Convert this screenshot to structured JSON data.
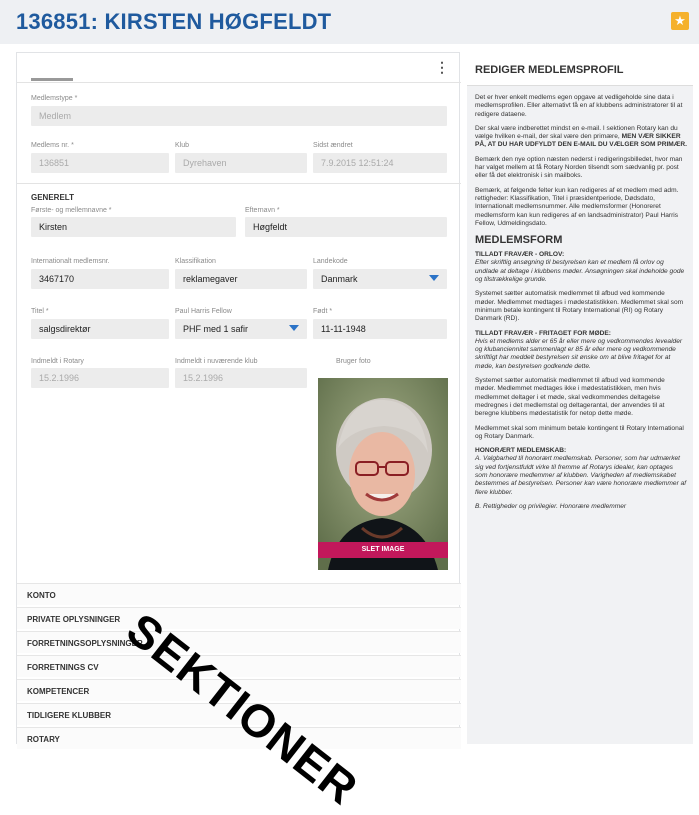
{
  "header": {
    "title": "136851: KIRSTEN HØGFELDT"
  },
  "left": {
    "fields": {
      "medlemstype": {
        "label": "Medlemstype *",
        "value": "Medlem"
      },
      "medlemsnr": {
        "label": "Medlems nr. *",
        "value": "136851"
      },
      "klub": {
        "label": "Klub",
        "value": "Dyrehaven"
      },
      "sidst": {
        "label": "Sidst ændret",
        "value": "7.9.2015 12:51:24"
      },
      "section_generelt": "GENERELT",
      "fornavn": {
        "label": "Første- og mellemnavne *",
        "value": "Kirsten"
      },
      "efternavn": {
        "label": "Efternavn *",
        "value": "Høgfeldt"
      },
      "intl": {
        "label": "Internationalt medlemsnr.",
        "value": "3467170"
      },
      "klass": {
        "label": "Klassifikation",
        "value": "reklamegaver"
      },
      "land": {
        "label": "Landekode",
        "value": "Danmark"
      },
      "titel": {
        "label": "Titel *",
        "value": "salgsdirektør"
      },
      "phf": {
        "label": "Paul Harris Fellow",
        "value": "PHF med 1 safir"
      },
      "fodt": {
        "label": "Født *",
        "value": "11-11-1948"
      },
      "indmeldt_rotary": {
        "label": "Indmeldt i Rotary",
        "value": "15.2.1996"
      },
      "indmeldt_klub": {
        "label": "Indmeldt i nuværende klub",
        "value": "15.2.1996"
      },
      "photo_label": "Bruger foto"
    },
    "delete_image": "SLET IMAGE",
    "accordion": [
      "KONTO",
      "PRIVATE OPLYSNINGER",
      "FORRETNINGSOPLYSNINGER",
      "FORRETNINGS CV",
      "KOMPETENCER",
      "TIDLIGERE KLUBBER",
      "ROTARY"
    ]
  },
  "overlay": "SEKTIONER",
  "help": {
    "title": "REDIGER MEDLEMSPROFIL",
    "p1": "Det er hver enkelt medlems egen opgave at vedligeholde sine data i medlemsprofilen. Eller alternativt få en af klubbens administratorer til at redigere dataene.",
    "p2a": "Der skal være indberettet mindst en e-mail. I sektionen Rotary kan du vælge hvilken e-mail, der skal være den primære,",
    "p2b": "MEN VÆR SIKKER PÅ, AT DU HAR UDFYLDT DEN E-MAIL DU VÆLGER SOM PRIMÆR.",
    "p3": "Bemærk den nye option næsten nederst i redigeringsbilledet, hvor man har valget mellem at få Rotary Norden tilsendt som sædvanlig pr. post eller få det elektronisk i sin mailboks.",
    "p4": "Bemærk, at følgende felter kun kan redigeres af et medlem med adm. rettigheder: Klassifikation, Titel i præsidentperiode, Dødsdato, Internationalt medlemsnummer. Alle medlemsformer (Honoreret medlemsform kan kun redigeres af en landsadministrator) Paul Harris Fellow, Udmeldingsdato.",
    "h2": "MEDLEMSFORM",
    "h3a": "TILLADT FRAVÆR - ORLOV:",
    "p5": "Efter skriftlig ansøgning til bestyrelsen kan et medlem få orlov og undlade at deltage i klubbens møder. Ansøgningen skal indeholde gode og tilstrækkelige grunde.",
    "p6": "Systemet sætter automatisk medlemmet til afbud ved kommende møder. Medlemmet medtages i mødestatistikken. Medlemmet skal som minimum betale kontingent til Rotary International (RI) og Rotary Danmark (RD).",
    "h3b": "TILLADT FRAVÆR - FRITAGET FOR MØDE:",
    "p7": "Hvis et medlems alder er 65 år eller mere og vedkommendes levealder og klubanciennitet sammenlagt er 85 år eller mere og vedkommende skriftligt har meddelt bestyrelsen sit ønske om at blive fritaget for at møde, kan bestyrelsen godkende dette.",
    "p8": "Systemet sætter automatisk medlemmet til afbud ved kommende møder. Medlemmet medtages ikke i mødestatistikken, men hvis medlemmet deltager i et møde, skal vedkommendes deltagelse medregnes i det medlemstal og deltagerantal, der anvendes til at beregne klubbens mødestatistik for netop dette møde.",
    "p9": "Medlemmet skal som minimum betale kontingent til Rotary International og Rotary Danmark.",
    "h3c": "HONORÆRT MEDLEMSKAB:",
    "p10": "A. Valgbarhed til honorært medlemskab. Personer, som har udmærket sig ved fortjenstfuldt virke til fremme af Rotarys idealer, kan optages som honorære medlemmer af klubben. Varigheden af medlemskabet bestemmes af bestyrelsen. Personer kan være honorære medlemmer af flere klubber.",
    "p11": "B. Rettigheder og privilegier. Honorære medlemmer"
  }
}
